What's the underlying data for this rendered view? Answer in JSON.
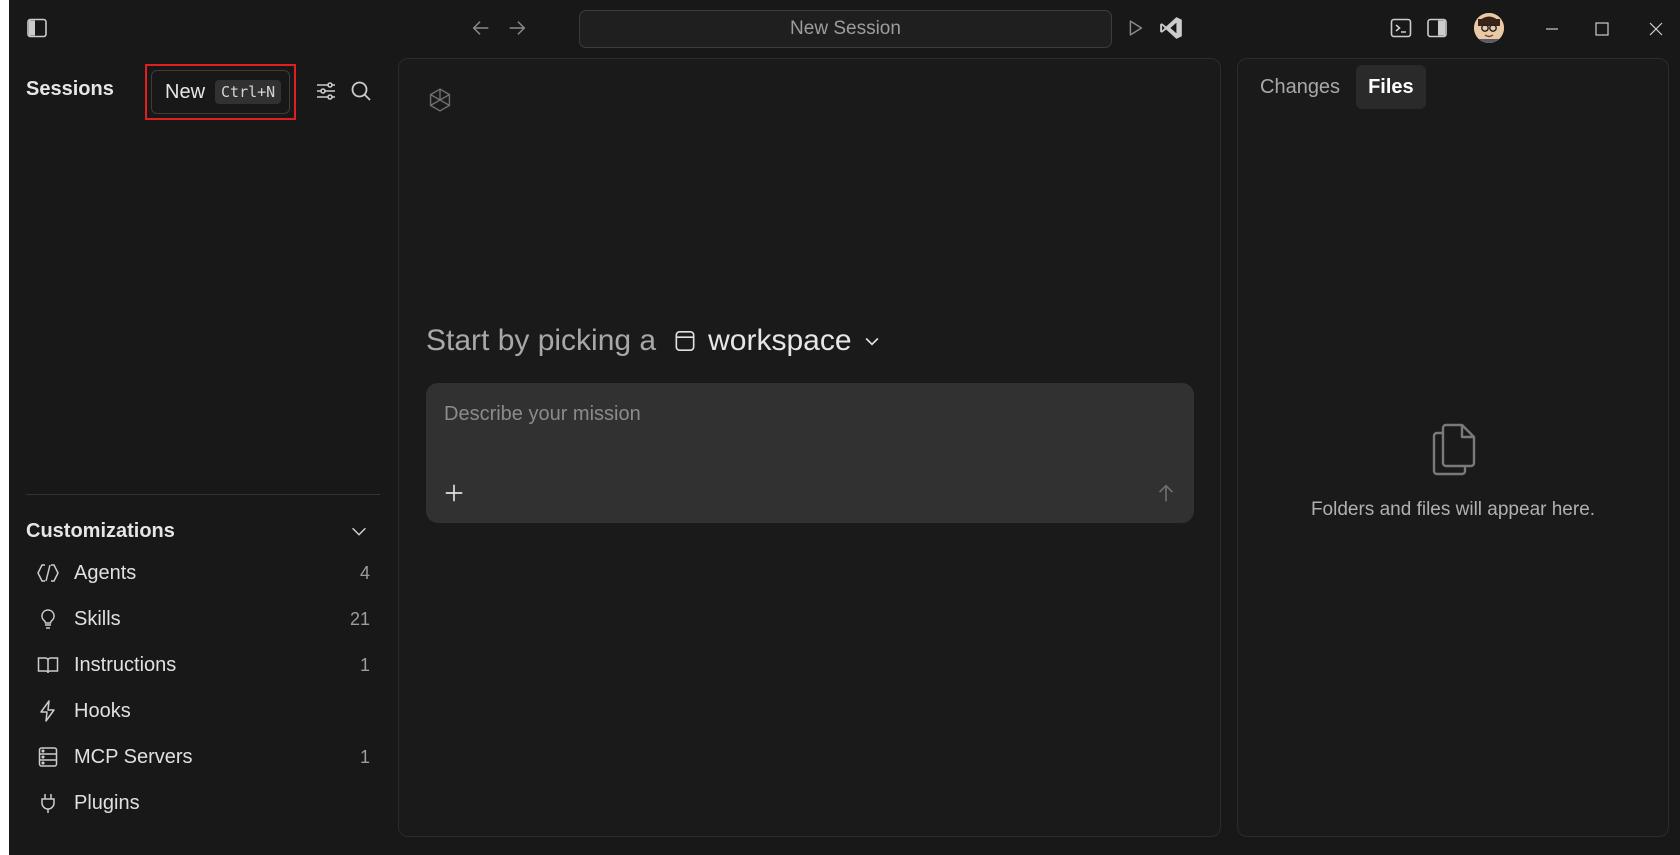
{
  "titlebar": {
    "address_text": "New Session"
  },
  "sidebar": {
    "title": "Sessions",
    "new_button": {
      "label": "New",
      "shortcut": "Ctrl+N"
    }
  },
  "customizations": {
    "title": "Customizations",
    "items": [
      {
        "label": "Agents",
        "count": "4",
        "icon": "agents-icon"
      },
      {
        "label": "Skills",
        "count": "21",
        "icon": "lightbulb-icon"
      },
      {
        "label": "Instructions",
        "count": "1",
        "icon": "book-icon"
      },
      {
        "label": "Hooks",
        "count": "",
        "icon": "lightning-icon"
      },
      {
        "label": "MCP Servers",
        "count": "1",
        "icon": "server-icon"
      },
      {
        "label": "Plugins",
        "count": "",
        "icon": "plug-icon"
      }
    ]
  },
  "main": {
    "pick_prefix": "Start by picking a",
    "workspace_label": "workspace",
    "composer_placeholder": "Describe your mission"
  },
  "right_panel": {
    "tabs": [
      {
        "label": "Changes",
        "active": false
      },
      {
        "label": "Files",
        "active": true
      }
    ],
    "empty_text": "Folders and files will appear here."
  },
  "colors": {
    "background": "#181818",
    "highlight_outline": "#e02020",
    "composer_bg": "#313131"
  }
}
